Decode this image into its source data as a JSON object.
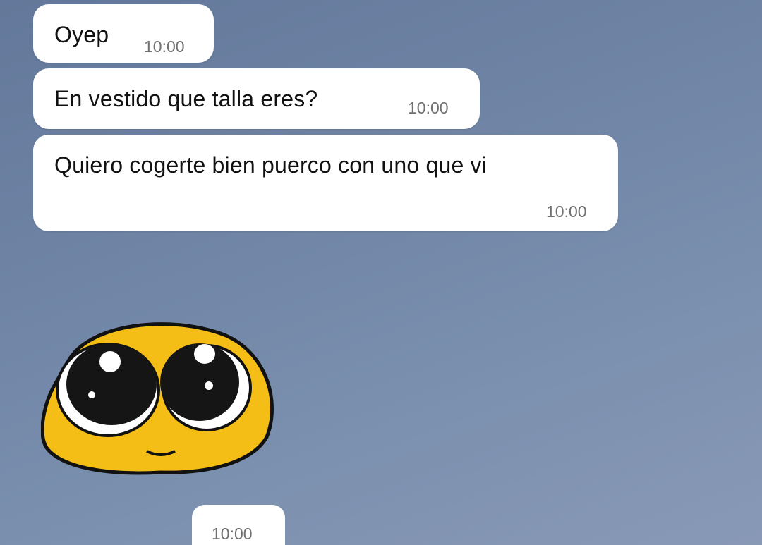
{
  "chat": {
    "messages": [
      {
        "text": "Oyep",
        "time": "10:00"
      },
      {
        "text": "En vestido que talla eres?",
        "time": "10:00"
      },
      {
        "text": "Quiero cogerte bien puerco con uno que vi",
        "time": "10:00"
      }
    ],
    "sticker": {
      "icon": "pleading-face-sticker",
      "time": "10:00"
    }
  },
  "colors": {
    "background": "#6f84a5",
    "bubble": "#ffffff",
    "timestamp": "#707070",
    "sticker_yellow": "#f5be17"
  }
}
